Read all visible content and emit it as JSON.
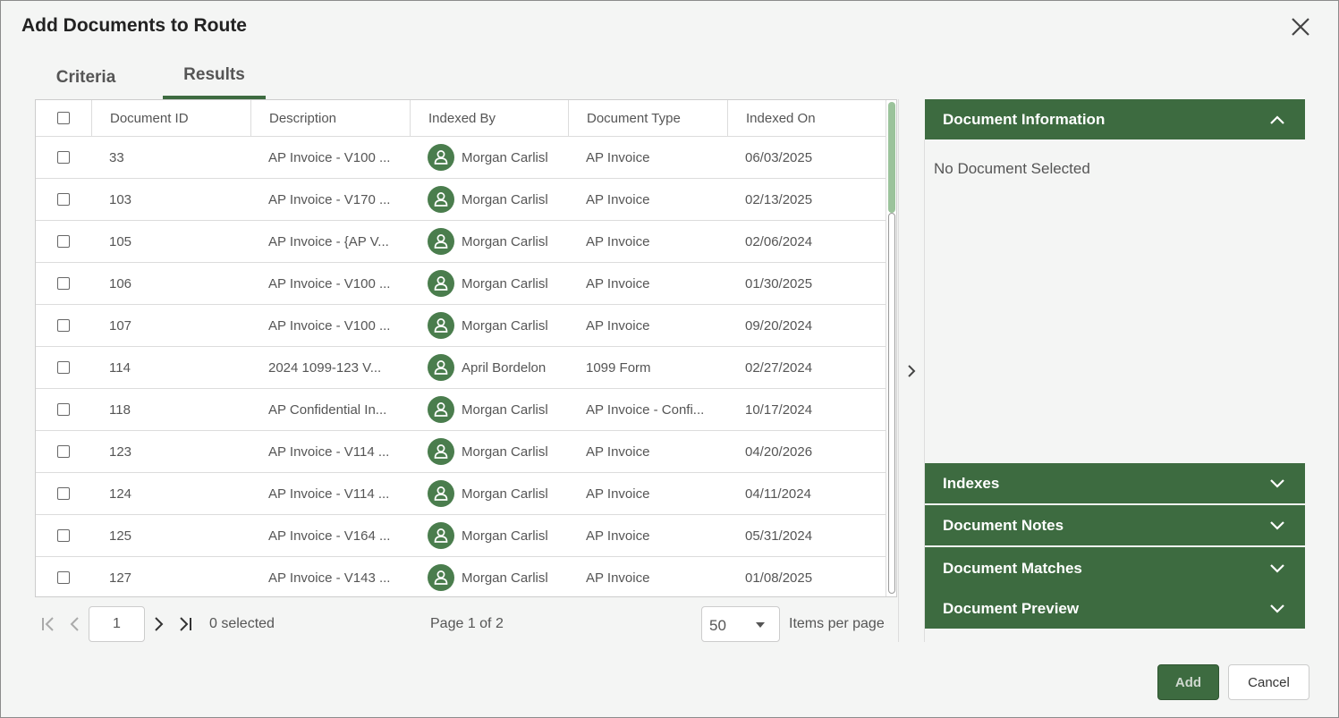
{
  "dialog": {
    "title": "Add Documents to Route"
  },
  "tabs": {
    "criteria": "Criteria",
    "results": "Results"
  },
  "grid": {
    "columns": [
      "Document ID",
      "Description",
      "Indexed By",
      "Document Type",
      "Indexed On"
    ],
    "rows": [
      {
        "id": "33",
        "description": "AP Invoice - V100 ...",
        "indexed_by": "Morgan Carlisl",
        "type": "AP Invoice",
        "indexed_on": "06/03/2025"
      },
      {
        "id": "103",
        "description": "AP Invoice - V170 ...",
        "indexed_by": "Morgan Carlisl",
        "type": "AP Invoice",
        "indexed_on": "02/13/2025"
      },
      {
        "id": "105",
        "description": "AP Invoice - {AP V...",
        "indexed_by": "Morgan Carlisl",
        "type": "AP Invoice",
        "indexed_on": "02/06/2024"
      },
      {
        "id": "106",
        "description": "AP Invoice - V100 ...",
        "indexed_by": "Morgan Carlisl",
        "type": "AP Invoice",
        "indexed_on": "01/30/2025"
      },
      {
        "id": "107",
        "description": "AP Invoice - V100 ...",
        "indexed_by": "Morgan Carlisl",
        "type": "AP Invoice",
        "indexed_on": "09/20/2024"
      },
      {
        "id": "114",
        "description": "2024 1099-123 V...",
        "indexed_by": "April Bordelon",
        "type": "1099 Form",
        "indexed_on": "02/27/2024"
      },
      {
        "id": "118",
        "description": "AP Confidential In...",
        "indexed_by": "Morgan Carlisl",
        "type": "AP Invoice - Confi...",
        "indexed_on": "10/17/2024"
      },
      {
        "id": "123",
        "description": "AP Invoice - V114 ...",
        "indexed_by": "Morgan Carlisl",
        "type": "AP Invoice",
        "indexed_on": "04/20/2026"
      },
      {
        "id": "124",
        "description": "AP Invoice - V114 ...",
        "indexed_by": "Morgan Carlisl",
        "type": "AP Invoice",
        "indexed_on": "04/11/2024"
      },
      {
        "id": "125",
        "description": "AP Invoice - V164 ...",
        "indexed_by": "Morgan Carlisl",
        "type": "AP Invoice",
        "indexed_on": "05/31/2024"
      },
      {
        "id": "127",
        "description": "AP Invoice - V143 ...",
        "indexed_by": "Morgan Carlisl",
        "type": "AP Invoice",
        "indexed_on": "01/08/2025"
      }
    ]
  },
  "pager": {
    "page_value": "1",
    "selected_text": "0 selected",
    "page_text": "Page 1 of 2",
    "items_per_page_value": "50",
    "items_per_page_label": "Items per page"
  },
  "side_panel": {
    "document_information": "Document Information",
    "no_selection": "No Document Selected",
    "indexes": "Indexes",
    "document_notes": "Document Notes",
    "document_matches": "Document Matches",
    "document_preview": "Document Preview"
  },
  "buttons": {
    "add": "Add",
    "cancel": "Cancel"
  },
  "colors": {
    "accent": "#3d6b40",
    "avatar": "#4a7d4d",
    "scroll_thumb": "#9bc39b"
  }
}
